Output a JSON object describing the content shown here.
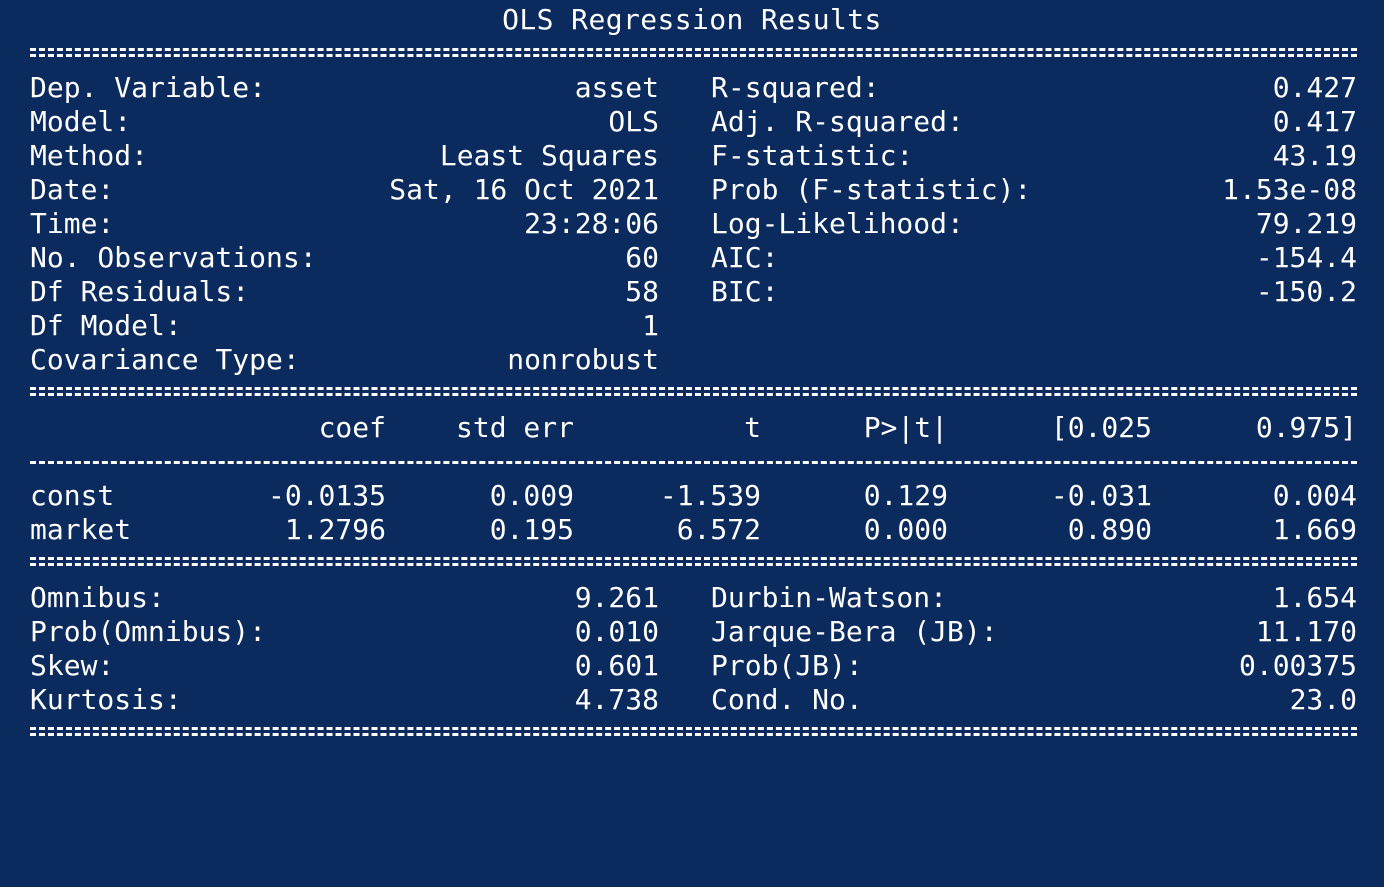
{
  "title": "OLS Regression Results",
  "model_info": [
    {
      "label_left": "Dep. Variable:",
      "value_left": "asset",
      "label_right": "R-squared:",
      "value_right": "0.427"
    },
    {
      "label_left": "Model:",
      "value_left": "OLS",
      "label_right": "Adj. R-squared:",
      "value_right": "0.417"
    },
    {
      "label_left": "Method:",
      "value_left": "Least Squares",
      "label_right": "F-statistic:",
      "value_right": "43.19"
    },
    {
      "label_left": "Date:",
      "value_left": "Sat, 16 Oct 2021",
      "label_right": "Prob (F-statistic):",
      "value_right": "1.53e-08"
    },
    {
      "label_left": "Time:",
      "value_left": "23:28:06",
      "label_right": "Log-Likelihood:",
      "value_right": "79.219"
    },
    {
      "label_left": "No. Observations:",
      "value_left": "60",
      "label_right": "AIC:",
      "value_right": "-154.4"
    },
    {
      "label_left": "Df Residuals:",
      "value_left": "58",
      "label_right": "BIC:",
      "value_right": "-150.2"
    },
    {
      "label_left": "Df Model:",
      "value_left": "1",
      "label_right": "",
      "value_right": ""
    },
    {
      "label_left": "Covariance Type:",
      "value_left": "nonrobust",
      "label_right": "",
      "value_right": ""
    }
  ],
  "coef_table": {
    "headers": [
      "coef",
      "std err",
      "t",
      "P>|t|",
      "[0.025",
      "0.975]"
    ],
    "rows": [
      {
        "name": "const",
        "values": [
          "-0.0135",
          "0.009",
          "-1.539",
          "0.129",
          "-0.031",
          "0.004"
        ]
      },
      {
        "name": "market",
        "values": [
          "1.2796",
          "0.195",
          "6.572",
          "0.000",
          "0.890",
          "1.669"
        ]
      }
    ]
  },
  "diagnostics": [
    {
      "label_left": "Omnibus:",
      "value_left": "9.261",
      "label_right": "Durbin-Watson:",
      "value_right": "1.654"
    },
    {
      "label_left": "Prob(Omnibus):",
      "value_left": "0.010",
      "label_right": "Jarque-Bera (JB):",
      "value_right": "11.170"
    },
    {
      "label_left": "Skew:",
      "value_left": "0.601",
      "label_right": "Prob(JB):",
      "value_right": "0.00375"
    },
    {
      "label_left": "Kurtosis:",
      "value_left": "4.738",
      "label_right": "Cond. No.",
      "value_right": "23.0"
    }
  ],
  "colors": {
    "background": "#0b2a5e",
    "text": "#ffffff"
  }
}
